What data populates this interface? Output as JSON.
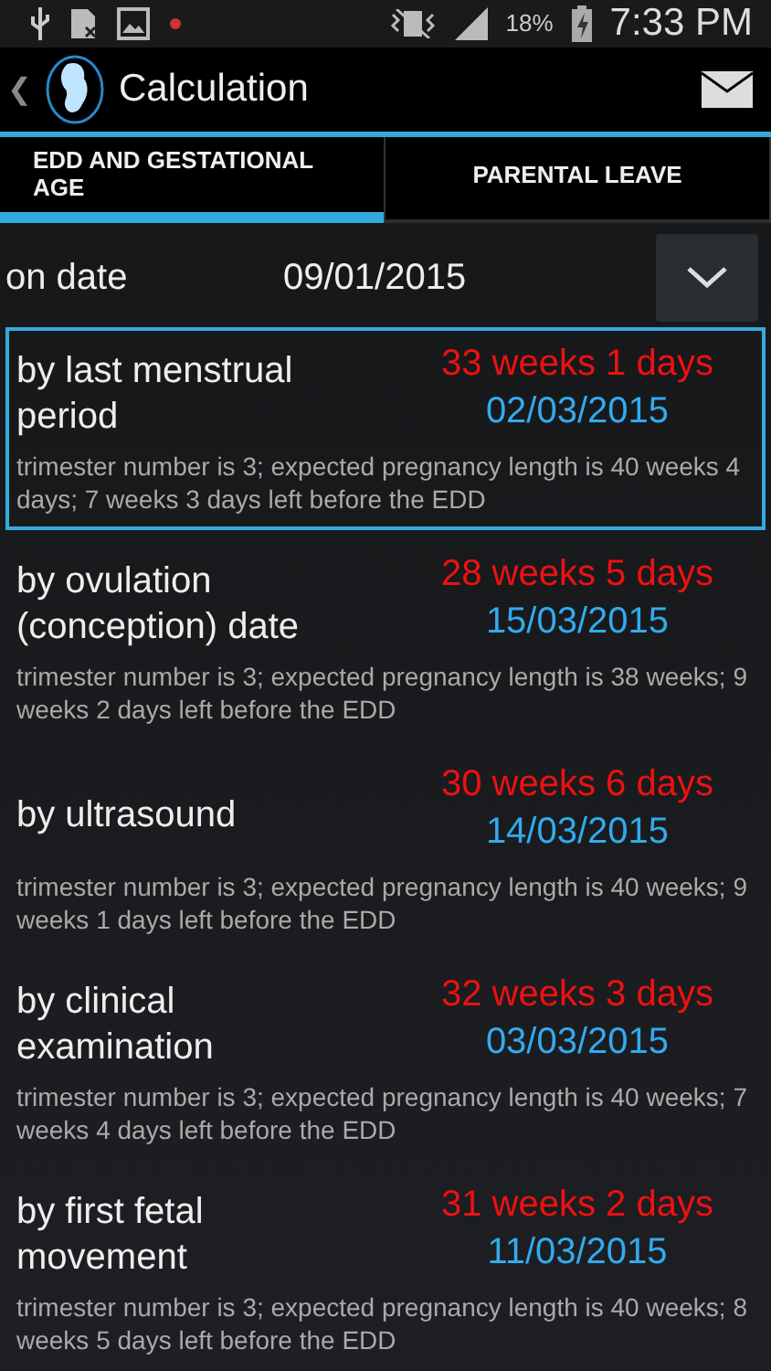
{
  "status_bar": {
    "battery": "18%",
    "time": "7:33 PM"
  },
  "action_bar": {
    "back": "❮",
    "title": "Calculation"
  },
  "tabs": [
    {
      "label": "EDD AND GESTATIONAL AGE",
      "selected": true
    },
    {
      "label": "PARENTAL LEAVE",
      "selected": false
    }
  ],
  "date_row": {
    "label": "on date",
    "value": "09/01/2015"
  },
  "methods": [
    {
      "name": "by last menstrual period",
      "age": "33 weeks 1 days",
      "edd": "02/03/2015",
      "details": "trimester number is 3; expected pregnancy length is 40 weeks 4 days; 7 weeks 3 days left before the EDD",
      "selected": true
    },
    {
      "name": "by ovulation (conception) date",
      "age": "28 weeks 5 days",
      "edd": "15/03/2015",
      "details": "trimester number is 3; expected pregnancy length is 38 weeks; 9 weeks 2 days left before the EDD",
      "selected": false
    },
    {
      "name": "by ultrasound",
      "age": "30 weeks 6 days",
      "edd": "14/03/2015",
      "details": "trimester number is 3; expected pregnancy length is 40 weeks; 9 weeks 1 days left before the EDD",
      "selected": false
    },
    {
      "name": "by clinical examination",
      "age": "32 weeks 3 days",
      "edd": "03/03/2015",
      "details": "trimester number is 3; expected pregnancy length is 40 weeks; 7 weeks 4 days left before the EDD",
      "selected": false
    },
    {
      "name": "by first fetal movement",
      "age": "31 weeks 2 days",
      "edd": "11/03/2015",
      "details": "trimester number is 3; expected pregnancy length is 40 weeks; 8 weeks 5 days left before the EDD",
      "selected": false
    }
  ]
}
